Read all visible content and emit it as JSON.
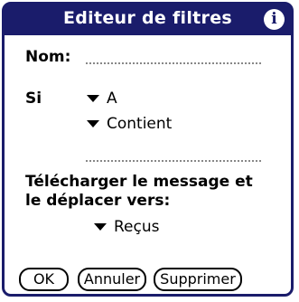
{
  "dialog": {
    "title": "Editeur de filtres",
    "info_icon": "i",
    "name_label": "Nom:",
    "condition_label": "Si",
    "field_dropdown": "A",
    "operator_dropdown": "Contient",
    "action_label_line1": "Télécharger le message et",
    "action_label_line2": "le déplacer vers:",
    "folder_dropdown": "Reçus"
  },
  "buttons": {
    "ok": "OK",
    "cancel": "Annuler",
    "delete": "Supprimer"
  }
}
